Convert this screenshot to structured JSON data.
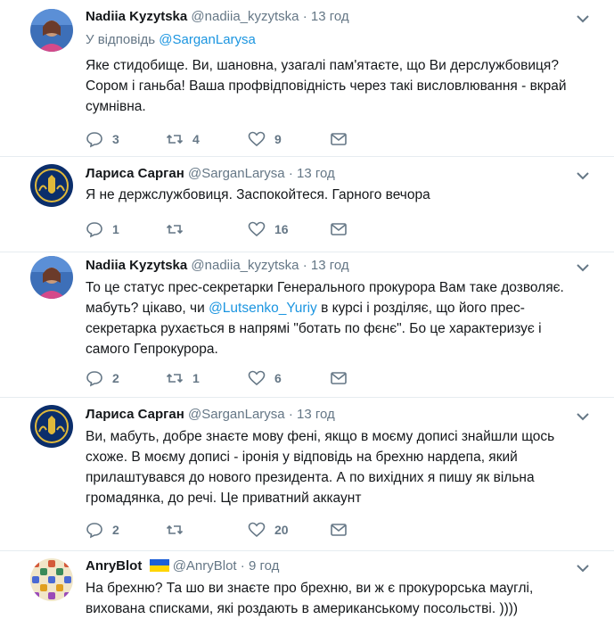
{
  "tweets": [
    {
      "name": "Nadiia Kyzytska",
      "handle": "@nadiia_kyzytska",
      "time": "13 год",
      "reply_prefix": "У відповідь",
      "reply_handle": "@SarganLarysa",
      "text": "Яке стидобище. Ви, шановна, узагалі пам'ятаєте, що Ви  дерслужбовиця? Сором і ганьба! Ваша профвідповідність через такі висловлювання - вкрай сумнівна.",
      "replies": "3",
      "retweets": "4",
      "likes": "9"
    },
    {
      "name": "Лариса Сарган",
      "handle": "@SarganLarysa",
      "time": "13 год",
      "text": "Я не держслужбовиця. Заспокойтеся. Гарного вечора",
      "replies": "1",
      "retweets": "",
      "likes": "16"
    },
    {
      "name": "Nadiia Kyzytska",
      "handle": "@nadiia_kyzytska",
      "time": "13 год",
      "text_before": "То це статус прес-секретарки Генерального прокурора Вам таке дозволяє. мабуть? цікаво, чи ",
      "mention": "@Lutsenko_Yuriy",
      "text_after": " в курсі і розділяє, що його прес-секретарка рухається в напрямі \"ботать по фєнє\". Бо це характеризує і самого Гепрокурора.",
      "replies": "2",
      "retweets": "1",
      "likes": "6"
    },
    {
      "name": "Лариса Сарган",
      "handle": "@SarganLarysa",
      "time": "13 год",
      "text": "Ви, мабуть, добре знаєте мову фені, якщо в моєму дописі знайшли щось схоже. В моєму дописі - іронія у відповідь на брехню нардепа, який прилаштувався до нового президента. А по вихідних я пишу як вільна громадянка, до речі. Це приватний аккаунт",
      "replies": "2",
      "retweets": "",
      "likes": "20"
    },
    {
      "name": "AnryBlot",
      "handle": "@AnryBlot",
      "time": "9 год",
      "text": "На брехню? Та шо ви знаєте про брехню, ви ж є прокурорська мауглі, вихована списками, які роздають в американському посольстві. ))))"
    }
  ],
  "separator": "·",
  "icons": [
    "reply-icon",
    "retweet-icon",
    "like-icon",
    "message-icon",
    "caret-down-icon",
    "ukraine-flag-icon"
  ],
  "colors": {
    "link": "#1b95e0",
    "muted": "#657786",
    "text": "#14171a",
    "divider": "#e6ecf0"
  }
}
